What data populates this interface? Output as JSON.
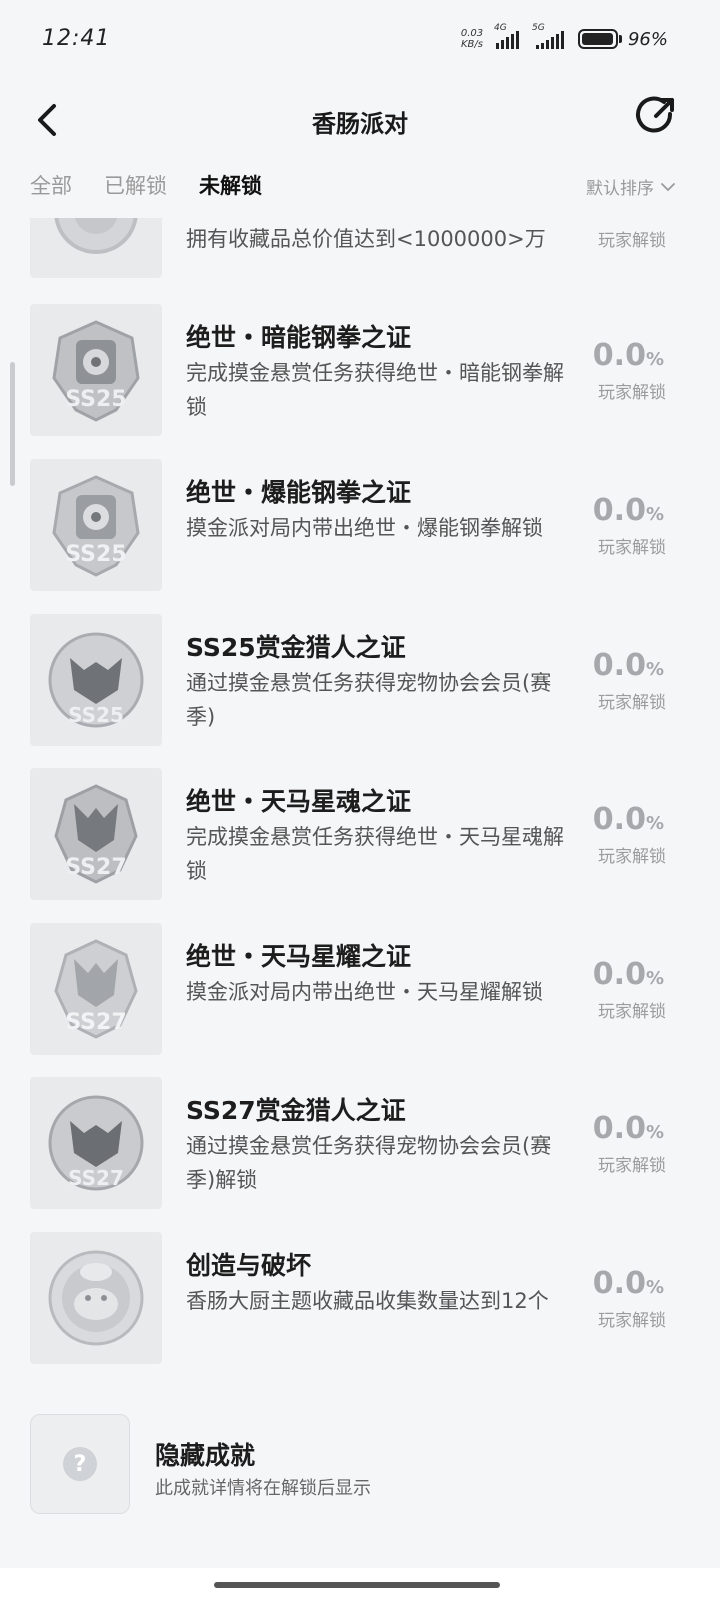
{
  "status_bar": {
    "time": "12:41",
    "net_speed_value": "0.03",
    "net_speed_unit": "KB/s",
    "signal1_label": "4G",
    "signal2_label": "5G",
    "battery_text": "96%",
    "battery_level": 0.96
  },
  "nav": {
    "title": "香肠派对",
    "back_icon": "chevron-left-icon",
    "share_icon": "share-arrow-icon"
  },
  "tabs": {
    "all": "全部",
    "unlocked": "已解锁",
    "locked": "未解锁",
    "active": "locked",
    "sort_label": "默认排序"
  },
  "achievements": [
    {
      "title": "",
      "desc": "拥有收藏品总价值达到<1000000>万",
      "pct": "",
      "pct_unit": "",
      "unlock_label": "玩家解锁",
      "badge": "partial-badge"
    },
    {
      "title": "绝世・暗能钢拳之证",
      "desc": "完成摸金悬赏任务获得绝世・暗能钢拳解锁",
      "pct": "0.0",
      "pct_unit": "%",
      "unlock_label": "玩家解锁",
      "badge": "SS25"
    },
    {
      "title": "绝世・爆能钢拳之证",
      "desc": "摸金派对局内带出绝世・爆能钢拳解锁",
      "pct": "0.0",
      "pct_unit": "%",
      "unlock_label": "玩家解锁",
      "badge": "SS25"
    },
    {
      "title": "SS25赏金猎人之证",
      "desc": "通过摸金悬赏任务获得宠物协会会员(赛季)",
      "pct": "0.0",
      "pct_unit": "%",
      "unlock_label": "玩家解锁",
      "badge": "SS25"
    },
    {
      "title": "绝世・天马星魂之证",
      "desc": "完成摸金悬赏任务获得绝世・天马星魂解锁",
      "pct": "0.0",
      "pct_unit": "%",
      "unlock_label": "玩家解锁",
      "badge": "SS27"
    },
    {
      "title": "绝世・天马星耀之证",
      "desc": "摸金派对局内带出绝世・天马星耀解锁",
      "pct": "0.0",
      "pct_unit": "%",
      "unlock_label": "玩家解锁",
      "badge": "SS27"
    },
    {
      "title": "SS27赏金猎人之证",
      "desc": "通过摸金悬赏任务获得宠物协会会员(赛季)解锁",
      "pct": "0.0",
      "pct_unit": "%",
      "unlock_label": "玩家解锁",
      "badge": "SS27"
    },
    {
      "title": "创造与破坏",
      "desc": "香肠大厨主题收藏品收集数量达到12个",
      "pct": "0.0",
      "pct_unit": "%",
      "unlock_label": "玩家解锁",
      "badge": ""
    }
  ],
  "hidden_achievement": {
    "title": "隐藏成就",
    "desc": "此成就详情将在解锁后显示",
    "icon": "question-mark-icon"
  }
}
